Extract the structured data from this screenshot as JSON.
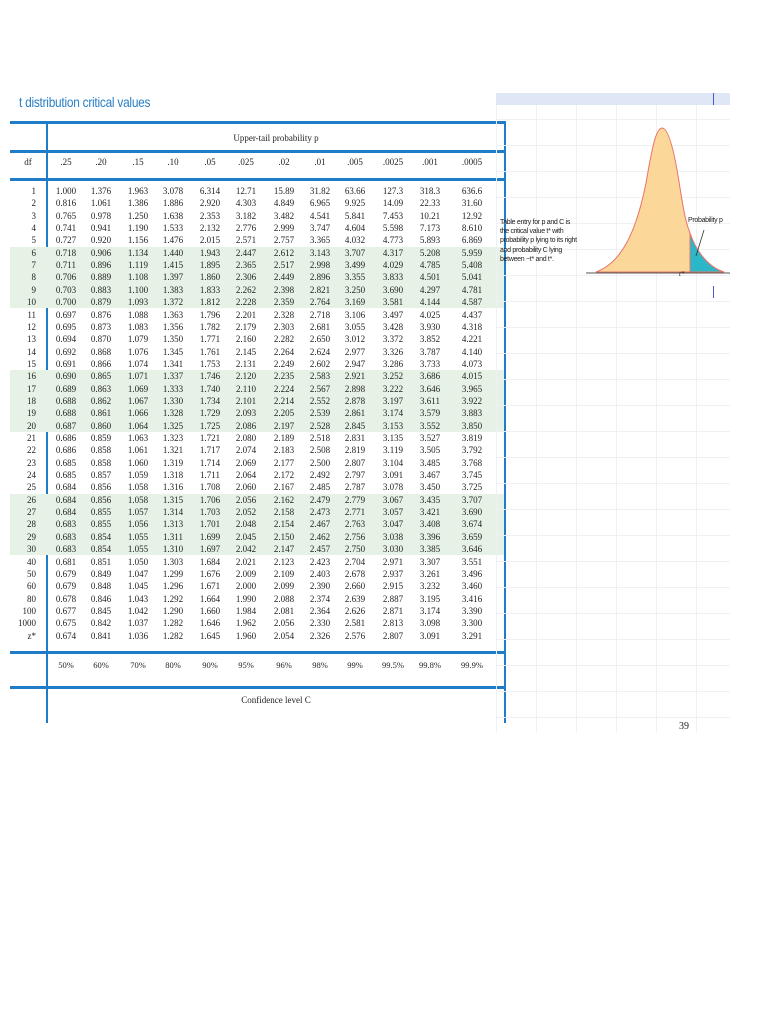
{
  "title": "t distribution critical values",
  "header": {
    "upper_tail_label": "Upper-tail probability p",
    "df_label": "df",
    "probabilities": [
      ".25",
      ".20",
      ".15",
      ".10",
      ".05",
      ".025",
      ".02",
      ".01",
      ".005",
      ".0025",
      ".001",
      ".0005"
    ]
  },
  "rows": [
    {
      "df": "1",
      "v": [
        "1.000",
        "1.376",
        "1.963",
        "3.078",
        "6.314",
        "12.71",
        "15.89",
        "31.82",
        "63.66",
        "127.3",
        "318.3",
        "636.6"
      ]
    },
    {
      "df": "2",
      "v": [
        "0.816",
        "1.061",
        "1.386",
        "1.886",
        "2.920",
        "4.303",
        "4.849",
        "6.965",
        "9.925",
        "14.09",
        "22.33",
        "31.60"
      ]
    },
    {
      "df": "3",
      "v": [
        "0.765",
        "0.978",
        "1.250",
        "1.638",
        "2.353",
        "3.182",
        "3.482",
        "4.541",
        "5.841",
        "7.453",
        "10.21",
        "12.92"
      ]
    },
    {
      "df": "4",
      "v": [
        "0.741",
        "0.941",
        "1.190",
        "1.533",
        "2.132",
        "2.776",
        "2.999",
        "3.747",
        "4.604",
        "5.598",
        "7.173",
        "8.610"
      ]
    },
    {
      "df": "5",
      "v": [
        "0.727",
        "0.920",
        "1.156",
        "1.476",
        "2.015",
        "2.571",
        "2.757",
        "3.365",
        "4.032",
        "4.773",
        "5.893",
        "6.869"
      ]
    },
    {
      "df": "6",
      "v": [
        "0.718",
        "0.906",
        "1.134",
        "1.440",
        "1.943",
        "2.447",
        "2.612",
        "3.143",
        "3.707",
        "4.317",
        "5.208",
        "5.959"
      ]
    },
    {
      "df": "7",
      "v": [
        "0.711",
        "0.896",
        "1.119",
        "1.415",
        "1.895",
        "2.365",
        "2.517",
        "2.998",
        "3.499",
        "4.029",
        "4.785",
        "5.408"
      ]
    },
    {
      "df": "8",
      "v": [
        "0.706",
        "0.889",
        "1.108",
        "1.397",
        "1.860",
        "2.306",
        "2.449",
        "2.896",
        "3.355",
        "3.833",
        "4.501",
        "5.041"
      ]
    },
    {
      "df": "9",
      "v": [
        "0.703",
        "0.883",
        "1.100",
        "1.383",
        "1.833",
        "2.262",
        "2.398",
        "2.821",
        "3.250",
        "3.690",
        "4.297",
        "4.781"
      ]
    },
    {
      "df": "10",
      "v": [
        "0.700",
        "0.879",
        "1.093",
        "1.372",
        "1.812",
        "2.228",
        "2.359",
        "2.764",
        "3.169",
        "3.581",
        "4.144",
        "4.587"
      ]
    },
    {
      "df": "11",
      "v": [
        "0.697",
        "0.876",
        "1.088",
        "1.363",
        "1.796",
        "2.201",
        "2.328",
        "2.718",
        "3.106",
        "3.497",
        "4.025",
        "4.437"
      ]
    },
    {
      "df": "12",
      "v": [
        "0.695",
        "0.873",
        "1.083",
        "1.356",
        "1.782",
        "2.179",
        "2.303",
        "2.681",
        "3.055",
        "3.428",
        "3.930",
        "4.318"
      ]
    },
    {
      "df": "13",
      "v": [
        "0.694",
        "0.870",
        "1.079",
        "1.350",
        "1.771",
        "2.160",
        "2.282",
        "2.650",
        "3.012",
        "3.372",
        "3.852",
        "4.221"
      ]
    },
    {
      "df": "14",
      "v": [
        "0.692",
        "0.868",
        "1.076",
        "1.345",
        "1.761",
        "2.145",
        "2.264",
        "2.624",
        "2.977",
        "3.326",
        "3.787",
        "4.140"
      ]
    },
    {
      "df": "15",
      "v": [
        "0.691",
        "0.866",
        "1.074",
        "1.341",
        "1.753",
        "2.131",
        "2.249",
        "2.602",
        "2.947",
        "3.286",
        "3.733",
        "4.073"
      ]
    },
    {
      "df": "16",
      "v": [
        "0.690",
        "0.865",
        "1.071",
        "1.337",
        "1.746",
        "2.120",
        "2.235",
        "2.583",
        "2.921",
        "3.252",
        "3.686",
        "4.015"
      ]
    },
    {
      "df": "17",
      "v": [
        "0.689",
        "0.863",
        "1.069",
        "1.333",
        "1.740",
        "2.110",
        "2.224",
        "2.567",
        "2.898",
        "3.222",
        "3.646",
        "3.965"
      ]
    },
    {
      "df": "18",
      "v": [
        "0.688",
        "0.862",
        "1.067",
        "1.330",
        "1.734",
        "2.101",
        "2.214",
        "2.552",
        "2.878",
        "3.197",
        "3.611",
        "3.922"
      ]
    },
    {
      "df": "19",
      "v": [
        "0.688",
        "0.861",
        "1.066",
        "1.328",
        "1.729",
        "2.093",
        "2.205",
        "2.539",
        "2.861",
        "3.174",
        "3.579",
        "3.883"
      ]
    },
    {
      "df": "20",
      "v": [
        "0.687",
        "0.860",
        "1.064",
        "1.325",
        "1.725",
        "2.086",
        "2.197",
        "2.528",
        "2.845",
        "3.153",
        "3.552",
        "3.850"
      ]
    },
    {
      "df": "21",
      "v": [
        "0.686",
        "0.859",
        "1.063",
        "1.323",
        "1.721",
        "2.080",
        "2.189",
        "2.518",
        "2.831",
        "3.135",
        "3.527",
        "3.819"
      ]
    },
    {
      "df": "22",
      "v": [
        "0.686",
        "0.858",
        "1.061",
        "1.321",
        "1.717",
        "2.074",
        "2.183",
        "2.508",
        "2.819",
        "3.119",
        "3.505",
        "3.792"
      ]
    },
    {
      "df": "23",
      "v": [
        "0.685",
        "0.858",
        "1.060",
        "1.319",
        "1.714",
        "2.069",
        "2.177",
        "2.500",
        "2.807",
        "3.104",
        "3.485",
        "3.768"
      ]
    },
    {
      "df": "24",
      "v": [
        "0.685",
        "0.857",
        "1.059",
        "1.318",
        "1.711",
        "2.064",
        "2.172",
        "2.492",
        "2.797",
        "3.091",
        "3.467",
        "3.745"
      ]
    },
    {
      "df": "25",
      "v": [
        "0.684",
        "0.856",
        "1.058",
        "1.316",
        "1.708",
        "2.060",
        "2.167",
        "2.485",
        "2.787",
        "3.078",
        "3.450",
        "3.725"
      ]
    },
    {
      "df": "26",
      "v": [
        "0.684",
        "0.856",
        "1.058",
        "1.315",
        "1.706",
        "2.056",
        "2.162",
        "2.479",
        "2.779",
        "3.067",
        "3.435",
        "3.707"
      ]
    },
    {
      "df": "27",
      "v": [
        "0.684",
        "0.855",
        "1.057",
        "1.314",
        "1.703",
        "2.052",
        "2.158",
        "2.473",
        "2.771",
        "3.057",
        "3.421",
        "3.690"
      ]
    },
    {
      "df": "28",
      "v": [
        "0.683",
        "0.855",
        "1.056",
        "1.313",
        "1.701",
        "2.048",
        "2.154",
        "2.467",
        "2.763",
        "3.047",
        "3.408",
        "3.674"
      ]
    },
    {
      "df": "29",
      "v": [
        "0.683",
        "0.854",
        "1.055",
        "1.311",
        "1.699",
        "2.045",
        "2.150",
        "2.462",
        "2.756",
        "3.038",
        "3.396",
        "3.659"
      ]
    },
    {
      "df": "30",
      "v": [
        "0.683",
        "0.854",
        "1.055",
        "1.310",
        "1.697",
        "2.042",
        "2.147",
        "2.457",
        "2.750",
        "3.030",
        "3.385",
        "3.646"
      ]
    },
    {
      "df": "40",
      "v": [
        "0.681",
        "0.851",
        "1.050",
        "1.303",
        "1.684",
        "2.021",
        "2.123",
        "2.423",
        "2.704",
        "2.971",
        "3.307",
        "3.551"
      ]
    },
    {
      "df": "50",
      "v": [
        "0.679",
        "0.849",
        "1.047",
        "1.299",
        "1.676",
        "2.009",
        "2.109",
        "2.403",
        "2.678",
        "2.937",
        "3.261",
        "3.496"
      ]
    },
    {
      "df": "60",
      "v": [
        "0.679",
        "0.848",
        "1.045",
        "1.296",
        "1.671",
        "2.000",
        "2.099",
        "2.390",
        "2.660",
        "2.915",
        "3.232",
        "3.460"
      ]
    },
    {
      "df": "80",
      "v": [
        "0.678",
        "0.846",
        "1.043",
        "1.292",
        "1.664",
        "1.990",
        "2.088",
        "2.374",
        "2.639",
        "2.887",
        "3.195",
        "3.416"
      ]
    },
    {
      "df": "100",
      "v": [
        "0.677",
        "0.845",
        "1.042",
        "1.290",
        "1.660",
        "1.984",
        "2.081",
        "2.364",
        "2.626",
        "2.871",
        "3.174",
        "3.390"
      ]
    },
    {
      "df": "1000",
      "v": [
        "0.675",
        "0.842",
        "1.037",
        "1.282",
        "1.646",
        "1.962",
        "2.056",
        "2.330",
        "2.581",
        "2.813",
        "3.098",
        "3.300"
      ]
    },
    {
      "df": "z*",
      "v": [
        "0.674",
        "0.841",
        "1.036",
        "1.282",
        "1.645",
        "1.960",
        "2.054",
        "2.326",
        "2.576",
        "2.807",
        "3.091",
        "3.291"
      ]
    }
  ],
  "confidence_levels": [
    "50%",
    "60%",
    "70%",
    "80%",
    "90%",
    "95%",
    "96%",
    "98%",
    "99%",
    "99.5%",
    "99.8%",
    "99.9%"
  ],
  "confidence_label": "Confidence level C",
  "figure": {
    "description_text": "Table entry for p and C is the critical value t* with probability p lying to its right and probability C lying between −t* and t*.",
    "probability_label": "Probability p",
    "tstar_label": "t*",
    "curve_color": "#fbd89a",
    "tail_color": "#2bb7c8"
  },
  "page_number": "39",
  "accent_color": "#1e7cc8"
}
